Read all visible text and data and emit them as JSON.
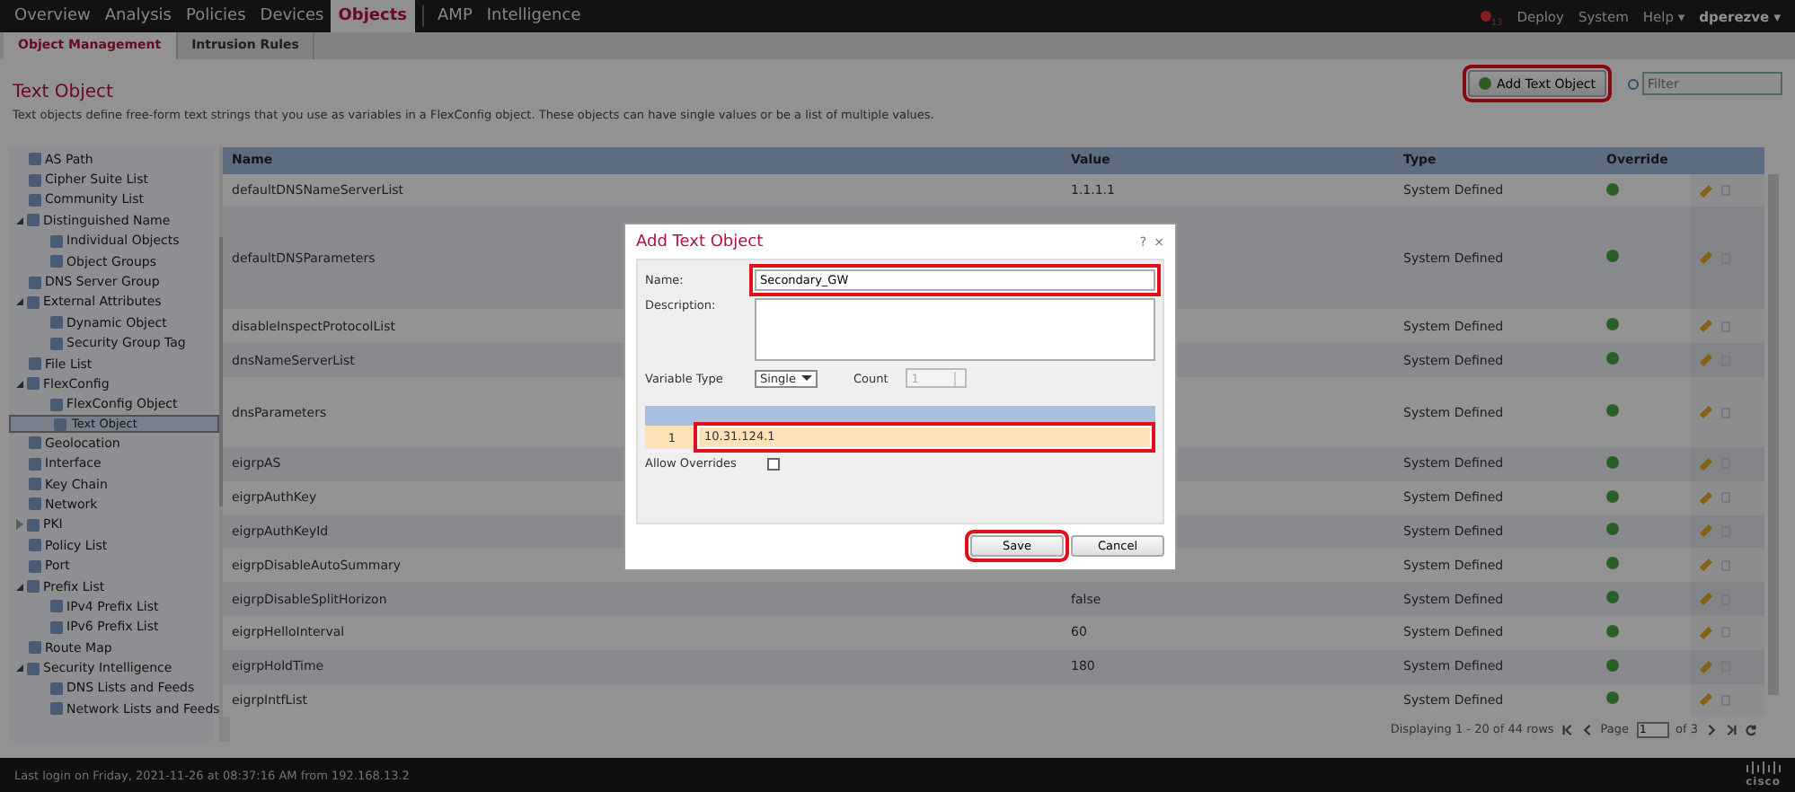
{
  "top_nav": {
    "tabs": [
      {
        "label": "Overview",
        "selected": false
      },
      {
        "label": "Analysis",
        "selected": false
      },
      {
        "label": "Policies",
        "selected": false
      },
      {
        "label": "Devices",
        "selected": false
      },
      {
        "label": "Objects",
        "selected": true
      },
      {
        "label": "AMP",
        "selected": false
      },
      {
        "label": "Intelligence",
        "selected": false
      }
    ],
    "alert_count": "13",
    "links": [
      "Deploy",
      "System",
      "Help ▾",
      "dperezve ▾"
    ]
  },
  "sub_tabs": [
    {
      "label": "Object Management",
      "selected": true
    },
    {
      "label": "Intrusion Rules",
      "selected": false
    }
  ],
  "page": {
    "title": "Text Object",
    "description": "Text objects define free-form text strings that you use as variables in a FlexConfig object. These objects can have single values or be a list of multiple values.",
    "add_button": {
      "label": "Add Text Object",
      "highlighted": true
    },
    "filter": {
      "placeholder": "Filter"
    }
  },
  "sidebar": {
    "items": [
      {
        "label": "AS Path",
        "selected": false
      },
      {
        "label": "Cipher Suite List",
        "selected": false
      },
      {
        "label": "Community List",
        "selected": false
      },
      {
        "label": "Distinguished Name",
        "selected": false,
        "expanded": true,
        "children": [
          {
            "label": "Individual Objects",
            "selected": false
          },
          {
            "label": "Object Groups",
            "selected": false
          }
        ]
      },
      {
        "label": "DNS Server Group",
        "selected": false
      },
      {
        "label": "External Attributes",
        "selected": false,
        "expanded": true,
        "children": [
          {
            "label": "Dynamic Object",
            "selected": false
          },
          {
            "label": "Security Group Tag",
            "selected": false
          }
        ]
      },
      {
        "label": "File List",
        "selected": false
      },
      {
        "label": "FlexConfig",
        "selected": false,
        "expanded": true,
        "children": [
          {
            "label": "FlexConfig Object",
            "selected": false
          },
          {
            "label": "Text Object",
            "selected": true
          }
        ]
      },
      {
        "label": "Geolocation",
        "selected": false
      },
      {
        "label": "Interface",
        "selected": false
      },
      {
        "label": "Key Chain",
        "selected": false
      },
      {
        "label": "Network",
        "selected": false
      },
      {
        "label": "PKI",
        "selected": false,
        "expanded": false
      },
      {
        "label": "Policy List",
        "selected": false
      },
      {
        "label": "Port",
        "selected": false
      },
      {
        "label": "Prefix List",
        "selected": false,
        "expanded": true,
        "children": [
          {
            "label": "IPv4 Prefix List",
            "selected": false
          },
          {
            "label": "IPv6 Prefix List",
            "selected": false
          }
        ]
      },
      {
        "label": "Route Map",
        "selected": false
      },
      {
        "label": "Security Intelligence",
        "selected": false,
        "expanded": true,
        "children": [
          {
            "label": "DNS Lists and Feeds",
            "selected": false
          },
          {
            "label": "Network Lists and Feeds",
            "selected": false
          }
        ]
      }
    ]
  },
  "table": {
    "columns": [
      "Name",
      "Value",
      "Type",
      "Override"
    ],
    "rows": [
      {
        "kind": "single",
        "name": "defaultDNSNameServerList",
        "value": "1.1.1.1",
        "type": "System Defined",
        "override": true
      },
      {
        "kind": "tall",
        "name": "defaultDNSParameters",
        "type": "System Defined",
        "override": true
      },
      {
        "kind": "single",
        "name": "disableInspectProtocolList",
        "type": "System Defined",
        "override": true
      },
      {
        "kind": "single",
        "name": "dnsNameServerList",
        "type": "System Defined",
        "override": true
      },
      {
        "kind": "medium",
        "name": "dnsParameters",
        "type": "System Defined",
        "override": true
      },
      {
        "kind": "single",
        "name": "eigrpAS",
        "type": "System Defined",
        "override": true
      },
      {
        "kind": "single",
        "name": "eigrpAuthKey",
        "type": "System Defined",
        "override": true
      },
      {
        "kind": "single",
        "name": "eigrpAuthKeyId",
        "type": "System Defined",
        "override": true
      },
      {
        "kind": "single",
        "name": "eigrpDisableAutoSummary",
        "type": "System Defined",
        "override": true
      },
      {
        "kind": "single",
        "name": "eigrpDisableSplitHorizon",
        "value": "false",
        "type": "System Defined",
        "override": true
      },
      {
        "kind": "single",
        "name": "eigrpHelloInterval",
        "value": "60",
        "type": "System Defined",
        "override": true
      },
      {
        "kind": "single",
        "name": "eigrpHoldTime",
        "value": "180",
        "type": "System Defined",
        "override": true
      },
      {
        "kind": "single",
        "name": "eigrpIntfList",
        "type": "System Defined",
        "override": true
      }
    ],
    "pagination": {
      "summary": "Displaying 1 - 20 of 44 rows",
      "page_label": "Page",
      "page": "1",
      "of": "of 3"
    }
  },
  "dialog": {
    "title": "Add Text Object",
    "help": "?",
    "close": "×",
    "name": {
      "label": "Name:",
      "value": "Secondary_GW",
      "highlighted": true
    },
    "description": {
      "label": "Description:"
    },
    "variable_type": {
      "label": "Variable Type",
      "value": "Single"
    },
    "count": {
      "label": "Count",
      "value": "1",
      "disabled": true
    },
    "values": [
      {
        "index": "1",
        "value": "10.31.124.1",
        "highlighted": true
      }
    ],
    "allow_overrides": {
      "label": "Allow Overrides",
      "checked": false
    },
    "buttons": [
      {
        "label": "Save",
        "highlighted": true
      },
      {
        "label": "Cancel",
        "highlighted": false
      }
    ]
  },
  "status_bar": {
    "text": "Last login on Friday, 2021-11-26 at 08:37:16 AM from 192.168.13.2",
    "logo": "cisco"
  }
}
